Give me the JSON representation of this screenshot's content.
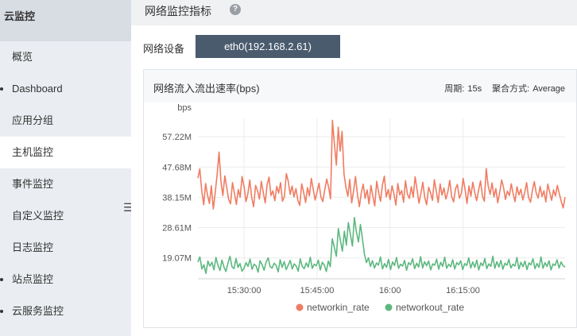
{
  "sidebar": {
    "title": "云监控",
    "items": [
      {
        "label": "概览",
        "dot": false,
        "active": false
      },
      {
        "label": "Dashboard",
        "dot": true,
        "active": false
      },
      {
        "label": "应用分组",
        "dot": false,
        "active": false
      },
      {
        "label": "主机监控",
        "dot": false,
        "active": true
      },
      {
        "label": "事件监控",
        "dot": false,
        "active": false
      },
      {
        "label": "自定义监控",
        "dot": false,
        "active": false
      },
      {
        "label": "日志监控",
        "dot": false,
        "active": false
      },
      {
        "label": "站点监控",
        "dot": true,
        "active": false
      },
      {
        "label": "云服务监控",
        "dot": true,
        "active": false
      }
    ],
    "collapse_icon": "list-collapse-icon"
  },
  "section": {
    "title": "网络监控指标",
    "help_icon": "question-circle-icon"
  },
  "device": {
    "label": "网络设备",
    "selected": "eth0(192.168.2.61)"
  },
  "panel": {
    "title": "网络流入流出速率(bps)",
    "period_label": "周期:",
    "period_value": "15s",
    "agg_label": "聚合方式:",
    "agg_value": "Average"
  },
  "chart_data": {
    "type": "line",
    "ylabel": "bps",
    "y_ticks": [
      "57.22M",
      "47.68M",
      "38.15M",
      "28.61M",
      "19.07M"
    ],
    "y_tick_values": [
      57.22,
      47.68,
      38.15,
      28.61,
      19.07
    ],
    "x_ticks": [
      "15:30:00",
      "15:45:00",
      "16:00",
      "16:15:00"
    ],
    "x_tick_minutes": [
      930,
      945,
      960,
      975
    ],
    "x_range_minutes": [
      920.5,
      996
    ],
    "ylim": [
      12.5,
      63
    ],
    "grid": true,
    "legend_position": "bottom",
    "colors": {
      "networkin_rate": "#f07c62",
      "networkout_rate": "#5cb87f"
    },
    "series": [
      {
        "name": "networkin_rate",
        "values": [
          44.2,
          47.1,
          40.3,
          35.8,
          42.5,
          38.9,
          36.2,
          41.8,
          34.5,
          39.6,
          45.3,
          52.4,
          43.1,
          38.7,
          44.9,
          41.2,
          37.5,
          36.1,
          42.8,
          39.4,
          35.9,
          40.6,
          38.2,
          44.7,
          41.5,
          36.8,
          39.3,
          43.6,
          38.1,
          35.2,
          41.9,
          40.3,
          37.6,
          43.2,
          39.8,
          36.4,
          42.1,
          44.5,
          38.7,
          40.2,
          37.1,
          41.6,
          39.5,
          42.8,
          36.9,
          38.4,
          45.6,
          43.2,
          39.1,
          41.7,
          38.3,
          40.9,
          37.2,
          35.6,
          42.4,
          39.8,
          36.5,
          41.2,
          38.6,
          44.1,
          40.7,
          37.3,
          39.9,
          42.6,
          38.2,
          36.8,
          40.5,
          43.9,
          41.3,
          37.7,
          62.4,
          55.1,
          48.3,
          60.2,
          52.7,
          58.9,
          45.6,
          41.2,
          38.5,
          43.8,
          36.4,
          40.1,
          44.7,
          38.9,
          35.2,
          39.6,
          42.3,
          37.8,
          40.5,
          36.1,
          41.9,
          38.6,
          35.4,
          43.2,
          39.7,
          36.9,
          42.1,
          44.8,
          38.3,
          40.6,
          37.4,
          41.8,
          39.2,
          35.7,
          42.5,
          38.9,
          40.3,
          36.6,
          43.4,
          39.1,
          37.8,
          41.5,
          38.2,
          44.6,
          40.7,
          36.3,
          39.4,
          42.9,
          38.1,
          35.8,
          41.3,
          39.6,
          37.2,
          43.7,
          40.1,
          36.5,
          42.4,
          38.8,
          41.1,
          37.6,
          39.9,
          43.5,
          38.4,
          36.7,
          40.8,
          42.2,
          37.9,
          39.3,
          44.1,
          40.6,
          36.2,
          41.7,
          38.5,
          42.9,
          39.7,
          37.1,
          40.4,
          43.3,
          38.6,
          36.9,
          47.2,
          41.8,
          39.1,
          42.7,
          38.3,
          40.9,
          36.4,
          39.8,
          43.6,
          41.2,
          37.5,
          40.1,
          38.7,
          42.4,
          39.2,
          36.8,
          41.5,
          38.9,
          40.7,
          37.3,
          39.6,
          42.8,
          38.1,
          36.6,
          40.3,
          43.1,
          39.5,
          37.9,
          41.6,
          38.4,
          40.2,
          36.7,
          42.3,
          39.8,
          37.2,
          40.5,
          38.6,
          41.9,
          39.3,
          36.9,
          34.8,
          38.2
        ],
        "values_note": ""
      },
      {
        "name": "networkout_rate",
        "values": [
          17.8,
          19.4,
          15.6,
          16.9,
          14.2,
          18.1,
          16.5,
          17.7,
          15.3,
          19.2,
          16.8,
          15.1,
          18.4,
          16.2,
          14.8,
          17.5,
          19.6,
          16.3,
          15.7,
          18.9,
          16.1,
          17.3,
          14.9,
          15.8,
          17.6,
          16.4,
          18.7,
          15.5,
          17.1,
          16.6,
          14.6,
          18.2,
          16.9,
          15.2,
          17.8,
          19.1,
          16.3,
          15.9,
          17.4,
          16.7,
          14.7,
          18.5,
          16.1,
          17.9,
          15.4,
          16.8,
          18.3,
          15.6,
          17.2,
          16.5,
          14.9,
          18.8,
          16.4,
          15.7,
          17.5,
          16.2,
          19.3,
          15.8,
          17.1,
          16.6,
          18.4,
          15.3,
          17.7,
          16.9,
          14.8,
          18.1,
          16.3,
          25.1,
          22.4,
          19.6,
          28.3,
          24.7,
          21.2,
          27.5,
          23.1,
          30.2,
          26.4,
          22.8,
          31.8,
          27.3,
          24.1,
          29.6,
          25.2,
          20.3,
          17.6,
          19.1,
          16.4,
          18.2,
          15.9,
          17.5,
          16.8,
          19.4,
          15.6,
          17.3,
          16.1,
          18.6,
          15.4,
          17.8,
          16.7,
          19.2,
          15.8,
          17.1,
          16.5,
          18.3,
          15.2,
          17.6,
          16.9,
          18.8,
          15.7,
          17.4,
          16.2,
          19.5,
          15.9,
          17.9,
          16.6,
          18.1,
          15.3,
          17.2,
          16.8,
          18.7,
          15.5,
          17.7,
          16.4,
          19.3,
          15.8,
          17.1,
          16.3,
          18.5,
          15.6,
          17.6,
          16.9,
          18.2,
          15.4,
          17.3,
          16.7,
          19.1,
          15.9,
          17.8,
          16.1,
          18.4,
          15.3,
          17.5,
          16.6,
          18.9,
          15.7,
          17.2,
          16.4,
          19.6,
          15.8,
          17.9,
          16.2,
          18.3,
          15.5,
          17.4,
          16.8,
          18.6,
          15.9,
          17.1,
          16.5,
          19.2,
          15.6,
          17.7,
          16.3,
          18.1,
          15.4,
          17.5,
          16.9,
          18.8,
          15.7,
          17.3,
          16.1,
          19.4,
          15.8,
          17.6,
          16.4,
          18.2,
          15.3,
          17.2,
          16.7,
          18.5,
          15.9,
          17.8,
          16.6,
          16.2
        ]
      }
    ]
  }
}
